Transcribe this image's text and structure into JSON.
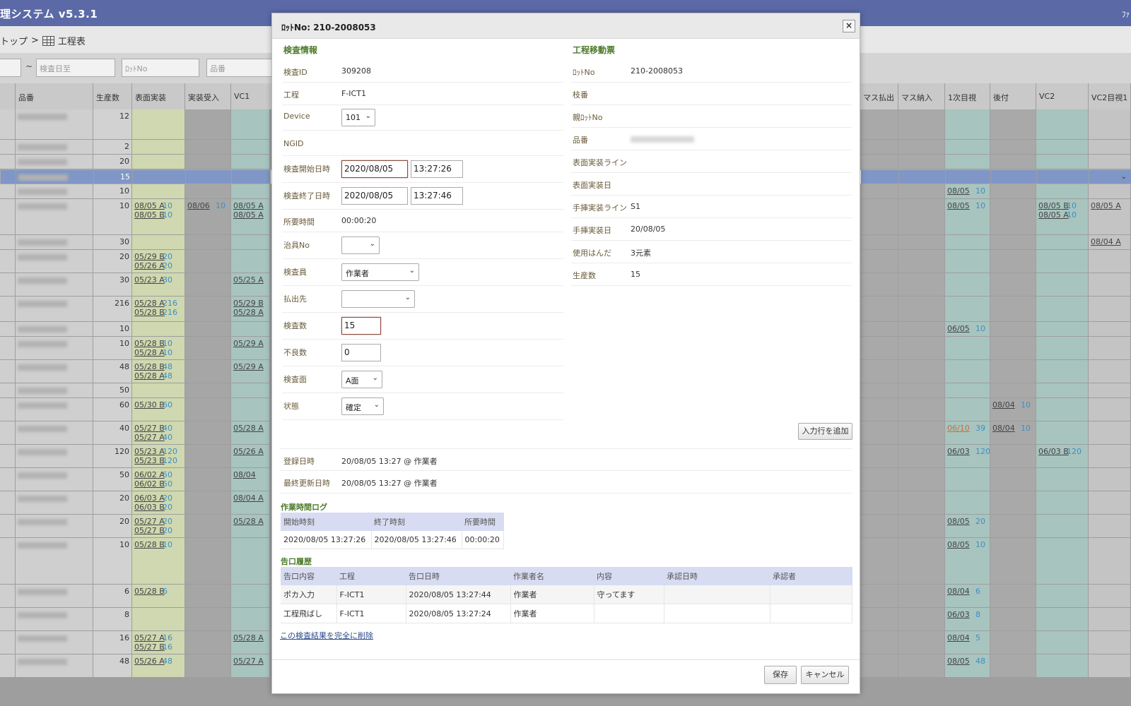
{
  "app": {
    "title": "理システム v5.3.1",
    "topright": "ﾌｧ",
    "breadcrumb_top": "トップ",
    "breadcrumb_sep": ">",
    "breadcrumb_current": "工程表"
  },
  "filters": {
    "date_to_placeholder": "検査日至",
    "lot_placeholder": "ﾛｯﾄNo",
    "part_placeholder": "品番",
    "tilde": "~"
  },
  "grid": {
    "headers_left": [
      "品番",
      "生産数",
      "表面実装",
      "実装受入",
      "VC1"
    ],
    "headers_right": [
      "マス払出",
      "マス納入",
      "1次目視",
      "後付",
      "VC2",
      "VC2目視1"
    ],
    "rows": [
      {
        "qty": "12",
        "sm": [],
        "ju": [],
        "vc": [],
        "r3": [],
        "r4": [],
        "r5": [],
        "r6": []
      },
      {
        "qty": "2"
      },
      {
        "qty": "20"
      },
      {
        "qty": "15",
        "selected": true
      },
      {
        "qty": "10",
        "r3": [
          [
            "08/05",
            "10"
          ]
        ]
      },
      {
        "qty": "10",
        "sm": [
          [
            "08/05 A",
            "10"
          ],
          [
            "08/05 B",
            "10"
          ]
        ],
        "ju": [
          [
            "08/06",
            "10"
          ]
        ],
        "vc": [
          [
            "08/05 A",
            ""
          ],
          [
            "08/05 A",
            ""
          ]
        ],
        "r3": [
          [
            "08/05",
            "10"
          ]
        ],
        "r5": [
          [
            "08/05 B",
            "10"
          ],
          [
            "08/05 A",
            "10"
          ]
        ],
        "r6": [
          [
            "08/05 A",
            ""
          ]
        ]
      },
      {
        "qty": "30",
        "r6": [
          [
            "08/04 A",
            ""
          ]
        ]
      },
      {
        "qty": "20",
        "sm": [
          [
            "05/29 B",
            "20"
          ],
          [
            "05/26 A",
            "20"
          ]
        ]
      },
      {
        "qty": "30",
        "sm": [
          [
            "05/23 A",
            "30"
          ]
        ],
        "vc": [
          [
            "05/25 A",
            ""
          ]
        ]
      },
      {
        "qty": "216",
        "sm": [
          [
            "05/28 A",
            "216"
          ],
          [
            "05/28 B",
            "216"
          ]
        ],
        "vc": [
          [
            "05/29 B",
            ""
          ],
          [
            "05/28 A",
            ""
          ]
        ]
      },
      {
        "qty": "10",
        "r3": [
          [
            "06/05",
            "10"
          ]
        ]
      },
      {
        "qty": "10",
        "sm": [
          [
            "05/28 B",
            "10"
          ],
          [
            "05/28 A",
            "10"
          ]
        ],
        "vc": [
          [
            "05/29 A",
            ""
          ]
        ]
      },
      {
        "qty": "48",
        "sm": [
          [
            "05/28 B",
            "48"
          ],
          [
            "05/28 A",
            "48"
          ]
        ],
        "vc": [
          [
            "05/29 A",
            ""
          ]
        ]
      },
      {
        "qty": "50"
      },
      {
        "qty": "60",
        "sm": [
          [
            "05/30 B",
            "60"
          ]
        ],
        "r4": [
          [
            "08/04",
            "10"
          ]
        ]
      },
      {
        "qty": "40",
        "sm": [
          [
            "05/27 B",
            "40"
          ],
          [
            "05/27 A",
            "40"
          ]
        ],
        "vc": [
          [
            "05/28 A",
            ""
          ]
        ],
        "r3o": [
          [
            "06/10",
            "39"
          ]
        ],
        "r4": [
          [
            "08/04",
            "10"
          ]
        ]
      },
      {
        "qty": "120",
        "sm": [
          [
            "05/23 A",
            "120"
          ],
          [
            "05/23 B",
            "120"
          ]
        ],
        "vc": [
          [
            "05/26 A",
            ""
          ]
        ],
        "r3": [
          [
            "06/03",
            "120"
          ]
        ],
        "r5": [
          [
            "06/03 B",
            "120"
          ]
        ]
      },
      {
        "qty": "50",
        "sm": [
          [
            "06/02 A",
            "50"
          ],
          [
            "06/02 B",
            "50"
          ]
        ],
        "vc": [
          [
            "08/04",
            ""
          ]
        ]
      },
      {
        "qty": "20",
        "sm": [
          [
            "06/03 A",
            "20"
          ],
          [
            "06/03 B",
            "20"
          ]
        ],
        "vc": [
          [
            "08/04 A",
            ""
          ]
        ]
      },
      {
        "qty": "20",
        "sm": [
          [
            "05/27 A",
            "20"
          ],
          [
            "05/27 B",
            "20"
          ]
        ],
        "vc": [
          [
            "05/28 A",
            ""
          ]
        ],
        "r3": [
          [
            "08/05",
            "20"
          ]
        ]
      },
      {
        "qty": "10",
        "sm": [
          [
            "05/28 B",
            "10"
          ]
        ],
        "r3": [
          [
            "08/05",
            "10"
          ]
        ]
      },
      {
        "qty": "6",
        "sm": [
          [
            "05/28 B",
            "6"
          ]
        ],
        "r3": [
          [
            "08/04",
            "6"
          ]
        ]
      },
      {
        "qty": "8",
        "r3": [
          [
            "06/03",
            "8"
          ]
        ]
      },
      {
        "qty": "16",
        "sm": [
          [
            "05/27 A",
            "16"
          ],
          [
            "05/27 B",
            "16"
          ]
        ],
        "vc": [
          [
            "05/28 A",
            ""
          ]
        ],
        "r3": [
          [
            "08/04",
            "5"
          ]
        ]
      },
      {
        "qty": "48",
        "sm": [
          [
            "05/26 A",
            "48"
          ]
        ],
        "vc": [
          [
            "05/27 A",
            ""
          ]
        ],
        "r3": [
          [
            "08/05",
            "48"
          ]
        ]
      }
    ]
  },
  "modal": {
    "title": "ﾛｯﾄNo: 210-2008053",
    "close": "×",
    "left_title": "検査情報",
    "right_title": "工程移動票",
    "inspect_id_label": "検査ID",
    "inspect_id": "309208",
    "process_label": "工程",
    "process": "F-ICT1",
    "device_label": "Device",
    "device": "101",
    "ngid_label": "NGID",
    "start_label": "検査開始日時",
    "start_date": "2020/08/05",
    "start_time": "13:27:26",
    "end_label": "検査終了日時",
    "end_date": "2020/08/05",
    "end_time": "13:27:46",
    "duration_label": "所要時間",
    "duration": "00:00:20",
    "jig_label": "治具No",
    "jig": "",
    "inspector_label": "検査員",
    "inspector": "作業者",
    "dest_label": "払出先",
    "dest": "",
    "count_label": "検査数",
    "count": "15",
    "defect_label": "不良数",
    "defect": "0",
    "side_label": "検査面",
    "side": "A面",
    "state_label": "状態",
    "state": "確定",
    "lot_label": "ﾛｯﾄNo",
    "lot": "210-2008053",
    "branch_label": "枝番",
    "parent_label": "親ﾛｯﾄNo",
    "part_label": "品番",
    "sm_line_label": "表面実装ライン",
    "sm_date_label": "表面実装日",
    "hand_line_label": "手挿実装ライン",
    "hand_line": "S1",
    "hand_date_label": "手挿実装日",
    "hand_date": "20/08/05",
    "solder_label": "使用はんだ",
    "solder": "3元素",
    "prod_label": "生産数",
    "prod": "15",
    "add_row": "入力行を追加",
    "reg_label": "登録日時",
    "reg": "20/08/05 13:27 @ 作業者",
    "upd_label": "最終更新日時",
    "upd": "20/08/05 13:27 @ 作業者",
    "worklog_title": "作業時間ログ",
    "worklog_headers": [
      "開始時刻",
      "終了時刻",
      "所要時間"
    ],
    "worklog_row": [
      "2020/08/05 13:27:26",
      "2020/08/05 13:27:46",
      "00:00:20"
    ],
    "report_title": "告口履歴",
    "report_headers": [
      "告口内容",
      "工程",
      "告口日時",
      "作業者名",
      "内容",
      "承認日時",
      "承認者"
    ],
    "report_rows": [
      [
        "ポカ入力",
        "F-ICT1",
        "2020/08/05 13:27:44",
        "作業者",
        "守ってます",
        "",
        ""
      ],
      [
        "工程飛ばし",
        "F-ICT1",
        "2020/08/05 13:27:24",
        "作業者",
        "",
        "",
        ""
      ]
    ],
    "delete_link": "この検査結果を完全に削除",
    "save": "保存",
    "cancel": "キャンセル"
  }
}
